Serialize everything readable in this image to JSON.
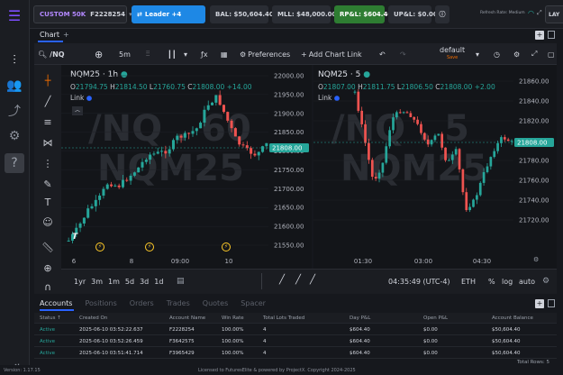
{
  "topbar": {
    "account_label": "CUSTOM 50K",
    "account_id": "F2228254",
    "leader_label": "Leader +4",
    "bal": "BAL: $50,604.40",
    "mll": "MLL: $48,000.00",
    "rpl": "RP&L: $604.40",
    "upl": "UP&L: $0.00",
    "refresh": "Refresh Rate: Medium",
    "layout": "LAY"
  },
  "chart_tabs": {
    "active": "Chart"
  },
  "toolbar": {
    "symbol": "/NQ",
    "interval": "5m",
    "preferences": "Preferences",
    "add_link": "Add Chart Link",
    "layout_name": "default",
    "layout_state": "Save"
  },
  "panes": [
    {
      "title": "NQM25 · 1h",
      "watermark1": "/NQ . 60",
      "watermark2": "NQM25",
      "o": "21794.75",
      "h": "21814.50",
      "l": "21760.75",
      "c": "21808.00",
      "chg": "+14.00",
      "link": "Link",
      "last": "21808.00",
      "yticks": [
        "22000.00",
        "21950.00",
        "21900.00",
        "21850.00",
        "21800.00",
        "21750.00",
        "21700.00",
        "21650.00",
        "21600.00",
        "21550.00"
      ],
      "xticks": [
        "6",
        "8",
        "09:00",
        "10"
      ]
    },
    {
      "title": "NQM25 · 5",
      "watermark1": "/NQ . 5",
      "watermark2": "NQM25",
      "o": "21807.00",
      "h": "21811.75",
      "l": "21806.50",
      "c": "21808.00",
      "chg": "+2.00",
      "link": "Link",
      "last": "21808.00",
      "yticks": [
        "21860.00",
        "21840.00",
        "21820.00",
        "21800.00",
        "21780.00",
        "21760.00",
        "21740.00",
        "21720.00"
      ],
      "xticks": [
        "01:30",
        "03:00",
        "04:30"
      ]
    }
  ],
  "chart_bottom": {
    "ranges": [
      "1yr",
      "3m",
      "1m",
      "5d",
      "3d",
      "1d"
    ],
    "clock": "04:35:49 (UTC-4)",
    "session": "ETH",
    "pct": "%",
    "log": "log",
    "auto": "auto"
  },
  "account_tabs": [
    "Accounts",
    "Positions",
    "Orders",
    "Trades",
    "Quotes",
    "Spacer"
  ],
  "table": {
    "headers": [
      "Status",
      "Created On",
      "Account Name",
      "Win Rate",
      "Total Lots Traded",
      "Day P&L",
      "Open P&L",
      "Account Balance"
    ],
    "rows": [
      [
        "Active",
        "2025-06-10 03:52:22.637",
        "F2228254",
        "100.00%",
        "4",
        "$604.40",
        "$0.00",
        "$50,604.40"
      ],
      [
        "Active",
        "2025-06-10 03:52:26.459",
        "F3642575",
        "100.00%",
        "4",
        "$604.40",
        "$0.00",
        "$50,604.40"
      ],
      [
        "Active",
        "2025-06-10 03:51:41.714",
        "F3965429",
        "100.00%",
        "4",
        "$604.40",
        "$0.00",
        "$50,604.40"
      ]
    ],
    "total_rows": "Total Rows: 5"
  },
  "footer": {
    "version": "Version: 1.17.15",
    "license": "Licensed to FuturesElite & powered by ProjectX. Copyright 2024-2025"
  },
  "colors": {
    "up": "#26a69a",
    "down": "#ef5350",
    "accent": "#7c4dff"
  }
}
